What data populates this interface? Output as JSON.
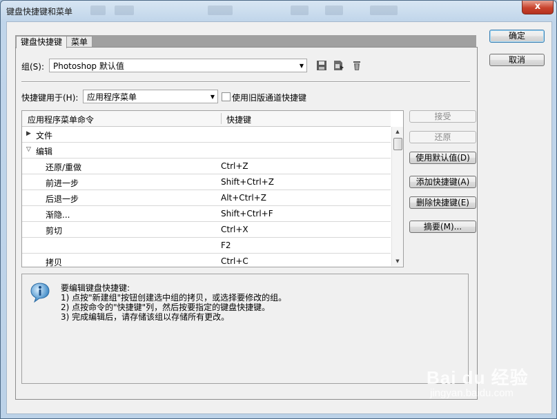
{
  "window": {
    "title": "键盘快捷键和菜单",
    "close_glyph": "x"
  },
  "tabs": [
    {
      "label": "键盘快捷键"
    },
    {
      "label": "菜单"
    }
  ],
  "set": {
    "label": "组(S):",
    "value": "Photoshop 默认值"
  },
  "shortcuts_for": {
    "label": "快捷键用于(H):",
    "value": "应用程序菜单"
  },
  "legacy_channel": {
    "label": "使用旧版通道快捷键",
    "checked": false
  },
  "table": {
    "headers": [
      "应用程序菜单命令",
      "快捷键"
    ],
    "rows": [
      {
        "type": "group",
        "expanded": false,
        "command": "文件",
        "shortcut": ""
      },
      {
        "type": "group",
        "expanded": true,
        "command": "编辑",
        "shortcut": ""
      },
      {
        "type": "item",
        "command": "还原/重做",
        "shortcut": "Ctrl+Z"
      },
      {
        "type": "item",
        "command": "前进一步",
        "shortcut": "Shift+Ctrl+Z"
      },
      {
        "type": "item",
        "command": "后退一步",
        "shortcut": "Alt+Ctrl+Z"
      },
      {
        "type": "item",
        "command": "渐隐...",
        "shortcut": "Shift+Ctrl+F"
      },
      {
        "type": "item",
        "command": "剪切",
        "shortcut": "Ctrl+X"
      },
      {
        "type": "item",
        "command": "",
        "shortcut": "F2"
      },
      {
        "type": "item",
        "command": "拷贝",
        "shortcut": "Ctrl+C"
      }
    ]
  },
  "side_buttons": {
    "accept": "接受",
    "undo": "还原",
    "use_default": "使用默认值(D)",
    "add_shortcut": "添加快捷键(A)",
    "delete_shortcut": "删除快捷键(E)",
    "summarize": "摘要(M)..."
  },
  "dialog_buttons": {
    "ok": "确定",
    "cancel": "取消"
  },
  "info": {
    "heading": "要编辑键盘快捷键:",
    "line1": "1) 点按\"新建组\"按钮创建选中组的拷贝，或选择要修改的组。",
    "line2": "2) 点按命令的\"快捷键\"列，然后按要指定的键盘快捷键。",
    "line3": "3) 完成编辑后，请存储该组以存储所有更改。"
  },
  "watermark": {
    "logo": "Bai du 经验",
    "url": "jingyan.baidu.com"
  },
  "colors": {
    "close_red": "#c8432d",
    "title_blue": "#bcd2e8",
    "info_blue": "#2f7fc0"
  }
}
